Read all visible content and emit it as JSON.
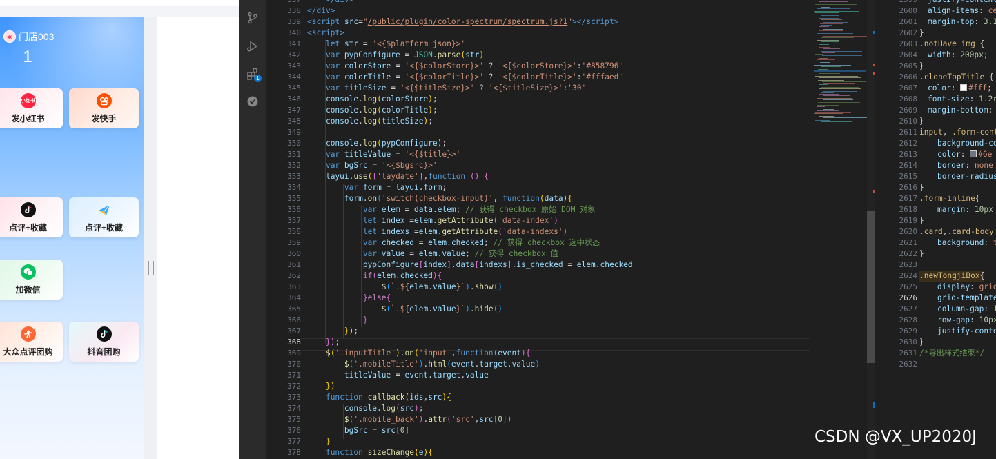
{
  "preview": {
    "store_name": "门店003",
    "count": "1",
    "buttons": [
      {
        "label": "发小红书",
        "icon": "xiaohongshu-icon",
        "icon_text": "小红书",
        "color": "#ff2442"
      },
      {
        "label": "发快手",
        "icon": "kuaishou-icon",
        "icon_text": "",
        "color": "#ff5000"
      },
      {
        "label": "点评+收藏",
        "icon": "douyin-icon",
        "icon_text": "",
        "color": "#111111"
      },
      {
        "label": "点评+收藏",
        "icon": "kuaishou-arrow-icon",
        "icon_text": "",
        "color": "#3aa8ff"
      },
      {
        "label": "加微信",
        "icon": "wechat-icon",
        "icon_text": "",
        "color": "#07c160"
      },
      {
        "label": "大众点评团购",
        "icon": "dianping-icon",
        "icon_text": "",
        "color": "#ff6633"
      },
      {
        "label": "抖音团购",
        "icon": "douyin-icon",
        "icon_text": "",
        "color": "#111111"
      }
    ]
  },
  "activity": {
    "extensions_badge": "1"
  },
  "editor": {
    "line_numbers": [
      "337",
      "338",
      "339",
      "340",
      "341",
      "342",
      "343",
      "344",
      "345",
      "346",
      "347",
      "348",
      "349",
      "350",
      "351",
      "352",
      "353",
      "354",
      "355",
      "356",
      "357",
      "358",
      "359",
      "360",
      "361",
      "362",
      "363",
      "364",
      "365",
      "366",
      "367",
      "368",
      "369",
      "370",
      "371",
      "372",
      "373",
      "374",
      "375",
      "376",
      "377",
      "378"
    ],
    "current_line": "368"
  },
  "css_pane": {
    "line_numbers": [
      "2599",
      "2600",
      "2601",
      "2602",
      "2603",
      "2604",
      "2605",
      "2606",
      "2607",
      "2608",
      "2609",
      "2610",
      "2611",
      "2612",
      "2613",
      "2614",
      "2615",
      "2616",
      "2617",
      "2618",
      "2619",
      "2620",
      "2621",
      "2622",
      "2623",
      "2624",
      "2625",
      "2626",
      "2627",
      "2628",
      "2629",
      "2630",
      "2631",
      "2632"
    ],
    "current_line": "2626"
  },
  "watermark": "CSDN @VX_UP2020J"
}
